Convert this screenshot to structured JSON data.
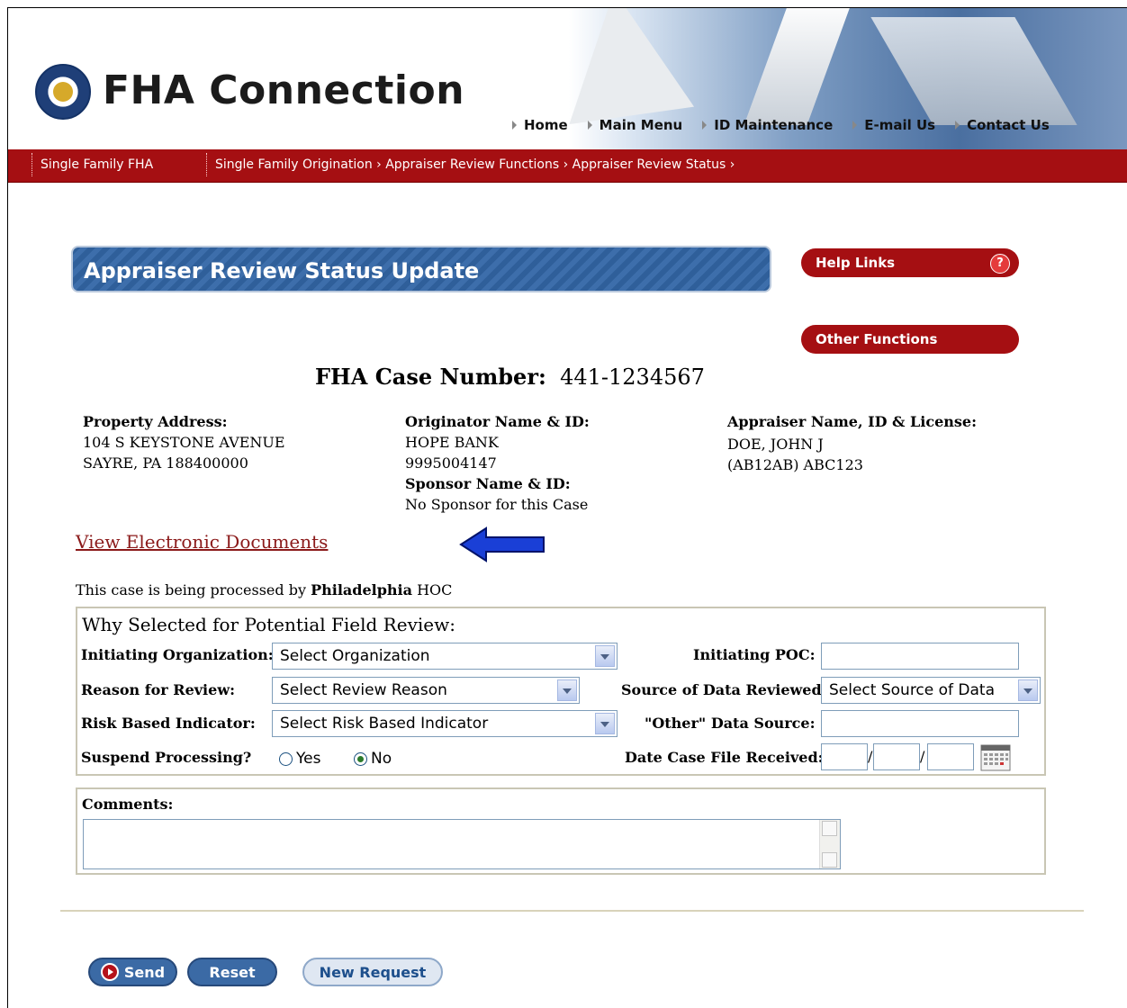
{
  "header": {
    "brand": "FHA Connection",
    "nav": [
      "Home",
      "Main Menu",
      "ID Maintenance",
      "E-mail Us",
      "Contact Us"
    ]
  },
  "breadcrumb": {
    "section": "Single Family FHA",
    "path": "Single Family Origination › Appraiser Review Functions › Appraiser Review Status ›"
  },
  "page_title": "Appraiser Review Status Update",
  "side_links": {
    "help": "Help Links",
    "help_icon": "?",
    "other": "Other Functions"
  },
  "case": {
    "label": "FHA Case Number:",
    "number": "441-1234567"
  },
  "property": {
    "label": "Property Address:",
    "line1": "104 S KEYSTONE AVENUE",
    "line2": "SAYRE, PA 188400000"
  },
  "originator": {
    "label": "Originator Name & ID:",
    "name": "HOPE BANK",
    "id": "9995004147",
    "sponsor_label": "Sponsor Name & ID:",
    "sponsor_value": "No Sponsor for this Case"
  },
  "appraiser": {
    "label": "Appraiser Name, ID & License:",
    "name": "DOE, JOHN J",
    "license": "(AB12AB) ABC123"
  },
  "docs_link": "View Electronic Documents",
  "processing": {
    "prefix": "This case is being processed by",
    "office": "Philadelphia",
    "suffix": "HOC"
  },
  "review": {
    "heading": "Why Selected for Potential Field Review:",
    "initiating_org_label": "Initiating Organization:",
    "initiating_org_value": "Select Organization",
    "initiating_poc_label": "Initiating POC:",
    "reason_label": "Reason for Review:",
    "reason_value": "Select Review Reason",
    "source_label": "Source of Data Reviewed:",
    "source_value": "Select Source of Data",
    "risk_label": "Risk Based Indicator:",
    "risk_value": "Select Risk Based Indicator",
    "other_source_label": "\"Other\" Data Source:",
    "suspend_label": "Suspend Processing?",
    "suspend_yes": "Yes",
    "suspend_no": "No",
    "suspend_selected": "No",
    "date_label": "Date Case File Received:"
  },
  "comments_label": "Comments:",
  "buttons": {
    "send": "Send",
    "reset": "Reset",
    "new_request": "New Request"
  },
  "colors": {
    "brand_red": "#a50f12",
    "title_blue": "#2f5f9a",
    "arrow_blue": "#1a3fd6"
  }
}
